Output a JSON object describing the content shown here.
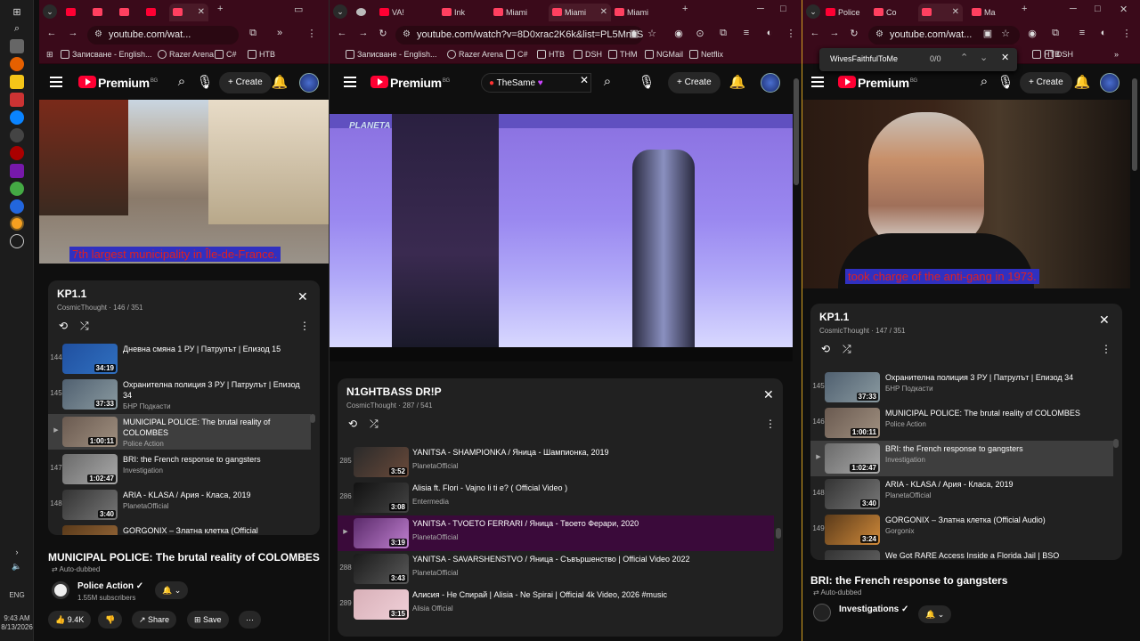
{
  "taskbar": {
    "time": "9:43 AM",
    "date": "8/13/2026",
    "lang": "ENG"
  },
  "left": {
    "tabs": [
      "",
      "",
      "",
      "",
      ""
    ],
    "url": "youtube.com/wat...",
    "bookmarks": [
      "Записване - English...",
      "Razer Arena",
      "C#",
      "НТВ"
    ],
    "brand": "Premium",
    "region": "BG",
    "create": "Create",
    "subtitle": "7th largest municipality in Île-de-France.",
    "playlist": {
      "title": "KP1.1",
      "sub": "CosmicThought · 146 / 351",
      "rows": [
        {
          "idx": "144",
          "title": "Дневна смяна 1 РУ | Патрулът | Епизод 15",
          "author": "БНР Подкасти",
          "dur": "34:19"
        },
        {
          "idx": "145",
          "title": "Охранителна полиция 3 РУ | Патрулът | Епизод 34",
          "author": "БНР Подкасти",
          "dur": "37:33"
        },
        {
          "idx": "▶",
          "title": "MUNICIPAL POLICE: The brutal reality of COLOMBES",
          "author": "Police Action",
          "dur": "1:00:11"
        },
        {
          "idx": "147",
          "title": "BRI: the French response to gangsters",
          "author": "Investigation",
          "dur": "1:02:47"
        },
        {
          "idx": "148",
          "title": "ARIA - KLASA / Ария - Класа, 2019",
          "author": "PlanetaOfficial",
          "dur": "3:40"
        },
        {
          "idx": "149",
          "title": "GORGONIX – Златна клетка (Official",
          "author": "",
          "dur": ""
        }
      ]
    },
    "video_title": "MUNICIPAL POLICE: The brutal reality of COLOMBES",
    "dub": "Auto-dubbed",
    "channel": "Police Action",
    "subscribers": "1.55M subscribers",
    "likes": "9.4K",
    "share": "Share",
    "save": "Save"
  },
  "middle": {
    "tabs": [
      "VA!",
      "Ink",
      "Miami",
      "Miami",
      "Miami"
    ],
    "url": "youtube.com/watch?v=8D0xrac2K6k&list=PL5Mn1SUkM...",
    "bookmarks": [
      "Записване - English...",
      "Razer Arena",
      "C#",
      "НТВ",
      "DSH",
      "ТНМ",
      "NGMail",
      "Netflix"
    ],
    "brand": "Premium",
    "region": "BG",
    "create": "Create",
    "search_chip": "TheSame",
    "watermark": "PLANETA 4K",
    "playlist": {
      "title": "N1GHTBASS DR!P",
      "sub": "CosmicThought · 287 / 541",
      "rows": [
        {
          "idx": "285",
          "title": "YANITSA - SHAMPIONKA / Яница - Шампионка, 2019",
          "author": "PlanetaOfficial",
          "dur": "3:52"
        },
        {
          "idx": "286",
          "title": "Alisia ft. Flori - Vajno li ti e? ( Official Video )",
          "author": "Entermedia",
          "dur": "3:08"
        },
        {
          "idx": "▶",
          "title": "YANITSA - TVOETO FERRARI / Яница - Твоето Ферари, 2020",
          "author": "PlanetaOfficial",
          "dur": "3:19"
        },
        {
          "idx": "288",
          "title": "YANITSA - SAVARSHENSTVO / Яница - Съвършенство | Official Video 2022",
          "author": "PlanetaOfficial",
          "dur": "3:43"
        },
        {
          "idx": "289",
          "title": "Алисия - Не Спирай | Alisia - Ne Spirai | Official 4k Video, 2026 #music",
          "author": "Alisia Official",
          "dur": "3:15"
        }
      ]
    }
  },
  "right": {
    "tabs": [
      "Police",
      "Co",
      "",
      "Ma"
    ],
    "url": "youtube.com/wat...",
    "find_text": "WivesFaithfulToMe",
    "find_count": "0/0",
    "bookmarks": [
      "НТВ",
      "DSH"
    ],
    "brand": "Premium",
    "region": "BG",
    "create": "Create",
    "subtitle": "took charge of the anti-gang in 1973.",
    "playlist": {
      "title": "KP1.1",
      "sub": "CosmicThought · 147 / 351",
      "rows": [
        {
          "idx": "145",
          "title": "Охранителна полиция 3 РУ | Патрулът | Епизод 34",
          "author": "БНР Подкасти",
          "dur": "37:33"
        },
        {
          "idx": "146",
          "title": "MUNICIPAL POLICE: The brutal reality of COLOMBES",
          "author": "Police Action",
          "dur": "1:00:11"
        },
        {
          "idx": "▶",
          "title": "BRI: the French response to gangsters",
          "author": "Investigation",
          "dur": "1:02:47"
        },
        {
          "idx": "148",
          "title": "ARIA - KLASA / Ария - Класа, 2019",
          "author": "PlanetaOfficial",
          "dur": "3:40"
        },
        {
          "idx": "149",
          "title": "GORGONIX – Златна клетка (Official Audio)",
          "author": "Gorgonix",
          "dur": "3:24"
        },
        {
          "idx": "150",
          "title": "We Got RARE Access Inside a Florida Jail | BSO",
          "author": "",
          "dur": ""
        }
      ]
    },
    "video_title": "BRI: the French response to gangsters",
    "dub": "Auto-dubbed",
    "channel": "Investigations"
  }
}
